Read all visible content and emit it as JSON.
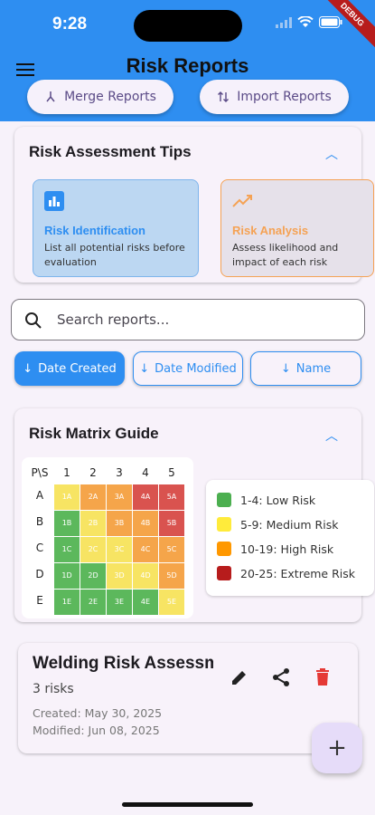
{
  "status": {
    "time": "9:28",
    "debug": "DEBUG"
  },
  "appbar": {
    "title": "Risk Reports",
    "merge_label": "Merge Reports",
    "import_label": "Import Reports"
  },
  "tips": {
    "title": "Risk Assessment Tips",
    "items": [
      {
        "title": "Risk Identification",
        "desc": "List all potential risks before evaluation",
        "color": "#2e8ef1"
      },
      {
        "title": "Risk Analysis",
        "desc": "Assess likelihood and impact of each risk",
        "color": "#f5a254"
      }
    ]
  },
  "search": {
    "placeholder": "Search reports..."
  },
  "sort": {
    "date_created": "Date Created",
    "date_modified": "Date Modified",
    "name": "Name"
  },
  "matrix": {
    "title": "Risk Matrix Guide",
    "corner": "P\\S",
    "cols": [
      "1",
      "2",
      "3",
      "4",
      "5"
    ],
    "rows": [
      "A",
      "B",
      "C",
      "D",
      "E"
    ],
    "cells": [
      [
        "1A",
        "2A",
        "3A",
        "4A",
        "5A"
      ],
      [
        "1B",
        "2B",
        "3B",
        "4B",
        "5B"
      ],
      [
        "1C",
        "2C",
        "3C",
        "4C",
        "5C"
      ],
      [
        "1D",
        "2D",
        "3D",
        "4D",
        "5D"
      ],
      [
        "1E",
        "2E",
        "3E",
        "4E",
        "5E"
      ]
    ],
    "legend": [
      {
        "label": "1-4: Low Risk",
        "color": "#4caf50"
      },
      {
        "label": "5-9: Medium Risk",
        "color": "#ffeb3b"
      },
      {
        "label": "10-19: High Risk",
        "color": "#ff9800"
      },
      {
        "label": "20-25: Extreme Risk",
        "color": "#b71c1c"
      }
    ]
  },
  "report": {
    "title": "Welding Risk Assessment",
    "risks": "3 risks",
    "created": "Created: May 30, 2025",
    "modified": "Modified: Jun 08, 2025"
  },
  "fab": {
    "label": "+"
  }
}
